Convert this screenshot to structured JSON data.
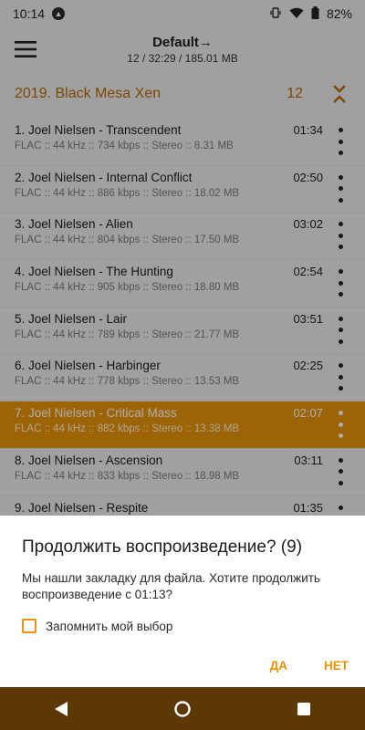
{
  "status": {
    "time": "10:14",
    "battery": "82%"
  },
  "toolbar": {
    "title": "Default→",
    "subtitle": "12 / 32:29 / 185.01 MB"
  },
  "album": {
    "title": "2019. Black Mesa Xen",
    "count": "12"
  },
  "tracks": [
    {
      "title": "1. Joel Nielsen - Transcendent",
      "duration": "01:34",
      "meta": "FLAC :: 44 kHz :: 734 kbps :: Stereo :: 8.31 MB"
    },
    {
      "title": "2. Joel Nielsen - Internal Conflict",
      "duration": "02:50",
      "meta": "FLAC :: 44 kHz :: 886 kbps :: Stereo :: 18.02 MB"
    },
    {
      "title": "3. Joel Nielsen - Alien",
      "duration": "03:02",
      "meta": "FLAC :: 44 kHz :: 804 kbps :: Stereo :: 17.50 MB"
    },
    {
      "title": "4. Joel Nielsen - The Hunting",
      "duration": "02:54",
      "meta": "FLAC :: 44 kHz :: 905 kbps :: Stereo :: 18.80 MB"
    },
    {
      "title": "5. Joel Nielsen - Lair",
      "duration": "03:51",
      "meta": "FLAC :: 44 kHz :: 789 kbps :: Stereo :: 21.77 MB"
    },
    {
      "title": "6. Joel Nielsen - Harbinger",
      "duration": "02:25",
      "meta": "FLAC :: 44 kHz :: 778 kbps :: Stereo :: 13.53 MB"
    },
    {
      "title": "7. Joel Nielsen - Critical Mass",
      "duration": "02:07",
      "meta": "FLAC :: 44 kHz :: 882 kbps :: Stereo :: 13.38 MB"
    },
    {
      "title": "8. Joel Nielsen - Ascension",
      "duration": "03:11",
      "meta": "FLAC :: 44 kHz :: 833 kbps :: Stereo :: 18.98 MB"
    },
    {
      "title": "9. Joel Nielsen - Respite",
      "duration": "01:35",
      "meta": ""
    }
  ],
  "active_track_index": 6,
  "dialog": {
    "title": "Продолжить воспроизведение? (9)",
    "message": "Мы нашли закладку для файла. Хотите продолжить воспроизведение с 01:13?",
    "checkbox_label": "Запомнить мой выбор",
    "checkbox_checked": false,
    "yes_label": "ДА",
    "no_label": "НЕТ"
  },
  "colors": {
    "accent": "#e8940a",
    "album_text": "#b86a06",
    "navbar": "#5c3807"
  },
  "icons": {
    "menu": "hamburger-icon",
    "collapse": "chevron-collapse-icon",
    "more": "more-vert-icon",
    "back": "back-triangle-icon",
    "home": "home-circle-icon",
    "recents": "recents-square-icon"
  }
}
